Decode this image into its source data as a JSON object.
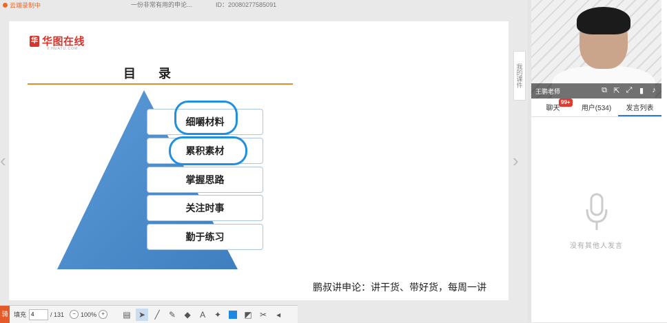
{
  "topbar": {
    "recording": "云端录制中",
    "title": "一份非常有用的申论...",
    "id": "ID：20080277585091"
  },
  "slide": {
    "logo_text": "华图在线",
    "logo_sub": "V.HUATU.COM",
    "heading": "目 录",
    "steps": [
      "细嚼材料",
      "累积素材",
      "掌握思路",
      "关注时事",
      "勤于练习"
    ],
    "footer": "鹏叔讲申论：讲干货、带好货，每周一讲"
  },
  "side_tab": {
    "label": "我的课件"
  },
  "toolbar": {
    "badge": "骑",
    "fill_label": "填充",
    "page_value": "4",
    "page_total": "/ 131",
    "zoom": "100%"
  },
  "video": {
    "teacher_name": "王鹏老师"
  },
  "tabs": [
    {
      "label": "聊天",
      "badge": "99+"
    },
    {
      "label": "用户(534)"
    },
    {
      "label": "发言列表"
    }
  ],
  "empty_state": {
    "text": "没有其他人发言"
  }
}
